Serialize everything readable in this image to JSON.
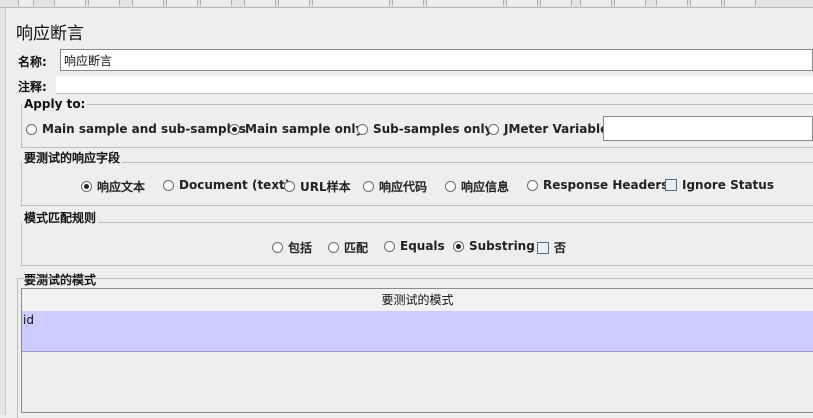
{
  "panel": {
    "title": "响应断言"
  },
  "name_field": {
    "label": "名称:",
    "value": "响应断言"
  },
  "comment_field": {
    "label": "注释:",
    "value": ""
  },
  "apply_to": {
    "title": "Apply to:",
    "options": [
      {
        "label": "Main sample and sub-samples",
        "checked": false
      },
      {
        "label": "Main sample only",
        "checked": true
      },
      {
        "label": "Sub-samples only",
        "checked": false
      },
      {
        "label": "JMeter Variable",
        "checked": false
      }
    ],
    "variable_value": ""
  },
  "response_field": {
    "title": "要测试的响应字段",
    "options": [
      {
        "label": "响应文本",
        "checked": true
      },
      {
        "label": "Document (text)",
        "checked": false
      },
      {
        "label": "URL样本",
        "checked": false
      },
      {
        "label": "响应代码",
        "checked": false
      },
      {
        "label": "响应信息",
        "checked": false
      },
      {
        "label": "Response Headers",
        "checked": false
      }
    ],
    "ignore_status": {
      "label": "Ignore Status",
      "checked": false
    }
  },
  "pattern_rules": {
    "title": "模式匹配规则",
    "options": [
      {
        "label": "包括",
        "checked": false
      },
      {
        "label": "匹配",
        "checked": false
      },
      {
        "label": "Equals",
        "checked": false
      },
      {
        "label": "Substring",
        "checked": true
      }
    ],
    "negate": {
      "label": "否",
      "checked": false
    }
  },
  "patterns": {
    "title": "要测试的模式",
    "column_header": "要测试的模式",
    "rows": [
      "id"
    ]
  }
}
